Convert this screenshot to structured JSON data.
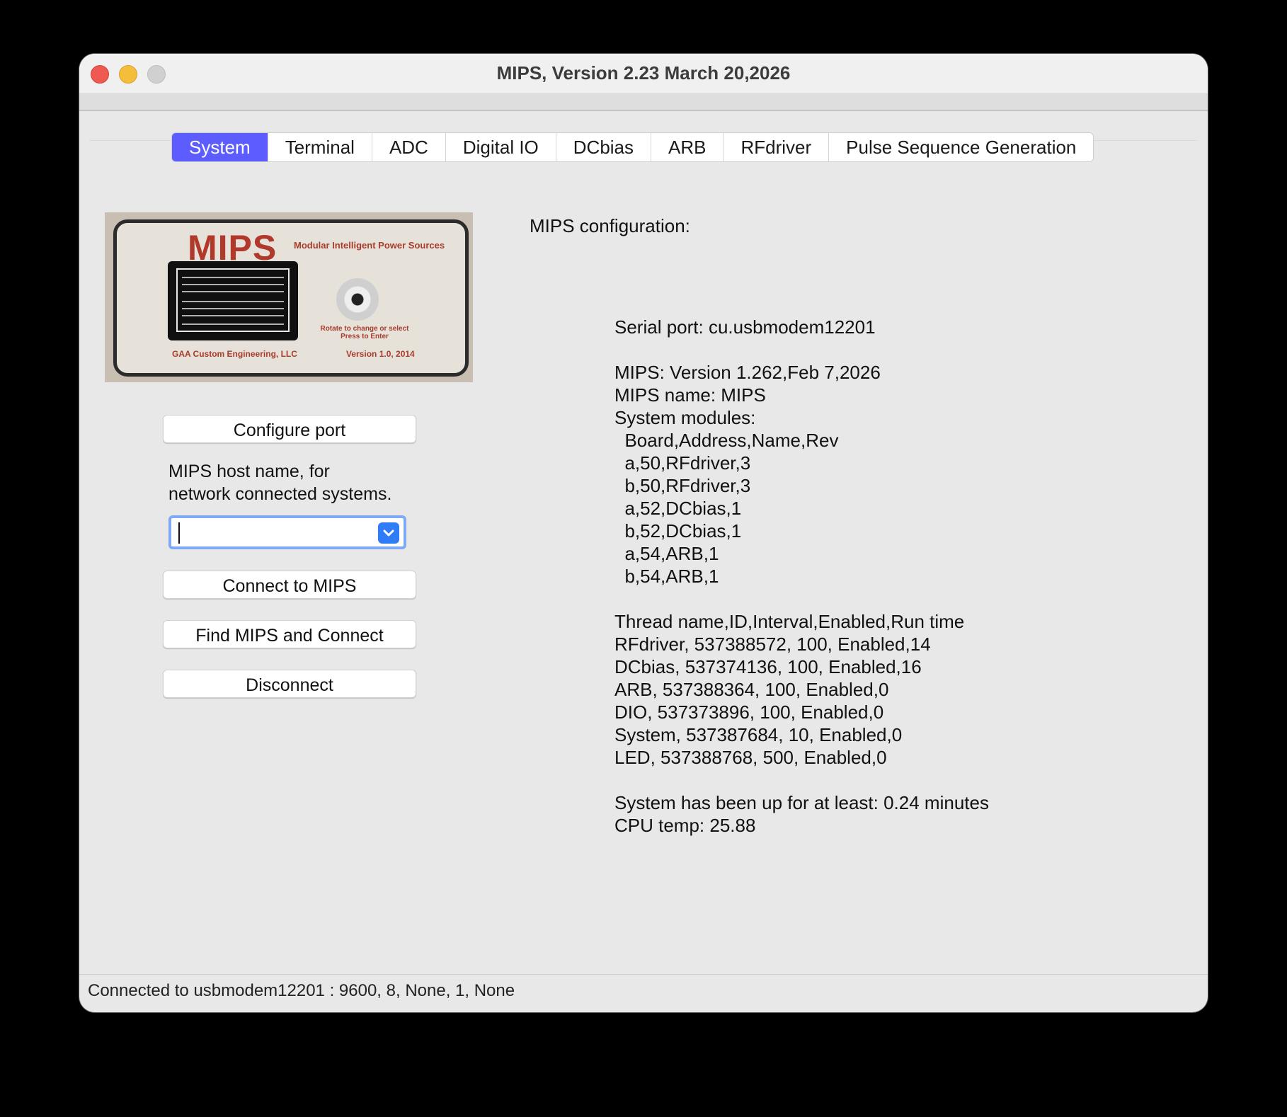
{
  "window": {
    "title": "MIPS, Version 2.23 March 20,2026"
  },
  "tabs": [
    {
      "label": "System",
      "active": true
    },
    {
      "label": "Terminal",
      "active": false
    },
    {
      "label": "ADC",
      "active": false
    },
    {
      "label": "Digital IO",
      "active": false
    },
    {
      "label": "DCbias",
      "active": false
    },
    {
      "label": "ARB",
      "active": false
    },
    {
      "label": "RFdriver",
      "active": false
    },
    {
      "label": "Pulse Sequence Generation",
      "active": false
    }
  ],
  "device_image": {
    "logo": "MIPS",
    "tagline": "Modular Intelligent Power Sources",
    "maker": "GAA Custom Engineering, LLC",
    "version": "Version 1.0, 2014",
    "knob_label": "Rotate to change or select Press to Enter"
  },
  "left": {
    "configure_port_label": "Configure port",
    "host_label": "MIPS host name, for\nnetwork connected systems.",
    "host_value": "",
    "connect_label": "Connect to MIPS",
    "find_connect_label": "Find MIPS and Connect",
    "disconnect_label": "Disconnect"
  },
  "config": {
    "label": "MIPS configuration:",
    "text": "Serial port: cu.usbmodem12201\n\nMIPS: Version 1.262,Feb 7,2026\nMIPS name: MIPS\nSystem modules:\n  Board,Address,Name,Rev\n  a,50,RFdriver,3\n  b,50,RFdriver,3\n  a,52,DCbias,1\n  b,52,DCbias,1\n  a,54,ARB,1\n  b,54,ARB,1\n\nThread name,ID,Interval,Enabled,Run time\nRFdriver, 537388572, 100, Enabled,14\nDCbias, 537374136, 100, Enabled,16\nARB, 537388364, 100, Enabled,0\nDIO, 537373896, 100, Enabled,0\nSystem, 537387684, 10, Enabled,0\nLED, 537388768, 500, Enabled,0\n\nSystem has been up for at least: 0.24 minutes\nCPU temp: 25.88"
  },
  "status_bar": {
    "text": "Connected to usbmodem12201 : 9600, 8, None, 1, None"
  },
  "colors": {
    "active_tab": "#5d5dff",
    "focus_ring": "#7daaf2",
    "combo_arrow": "#2f7df6"
  }
}
